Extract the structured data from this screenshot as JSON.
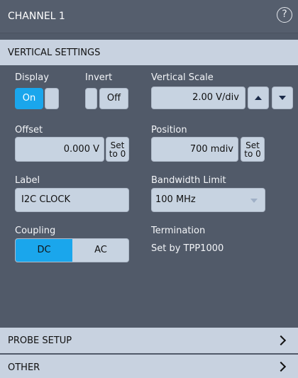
{
  "header": {
    "title": "CHANNEL 1",
    "help_glyph": "?"
  },
  "vertical": {
    "section_title": "VERTICAL SETTINGS"
  },
  "display": {
    "label": "Display",
    "on_label": "On",
    "state": "On"
  },
  "invert": {
    "label": "Invert",
    "off_label": "Off",
    "state": "Off"
  },
  "vscale": {
    "label": "Vertical Scale",
    "value": "2.00 V/div"
  },
  "offset": {
    "label": "Offset",
    "value": "0.000 V",
    "set_to_zero": [
      "Set",
      "to 0"
    ]
  },
  "position": {
    "label": "Position",
    "value": "700 mdiv",
    "set_to_zero": [
      "Set",
      "to 0"
    ]
  },
  "label_field": {
    "label": "Label",
    "value": "I2C CLOCK"
  },
  "bandwidth": {
    "label": "Bandwidth Limit",
    "value": "100 MHz"
  },
  "coupling": {
    "label": "Coupling",
    "options": [
      "DC",
      "AC"
    ],
    "selected": "DC"
  },
  "termination": {
    "label": "Termination",
    "value": "Set by TPP1000"
  },
  "sections": {
    "probe_setup": "PROBE SETUP",
    "other": "OTHER"
  },
  "colors": {
    "accent": "#1aa6ec",
    "section_bg": "#c8d2e0",
    "panel_bg": "#515a69"
  }
}
